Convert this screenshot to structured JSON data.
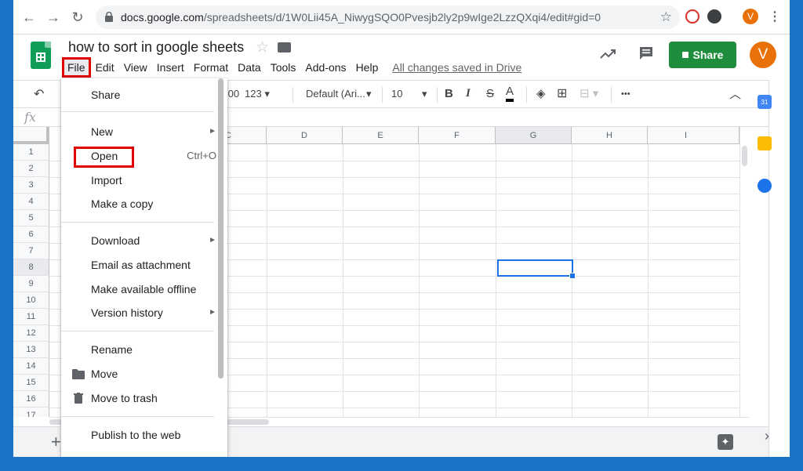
{
  "browser": {
    "url_host": "docs.google.com",
    "url_path": "/spreadsheets/d/1W0Lii45A_NiwygSQO0Pvesjb2ly2p9wIge2LzzQXqi4/edit#gid=0",
    "profile_initial": "V"
  },
  "header": {
    "doc_title": "how to sort in google sheets",
    "saved_status": "All changes saved in Drive",
    "share_label": "Share",
    "profile_initial": "V"
  },
  "menubar": [
    "File",
    "Edit",
    "View",
    "Insert",
    "Format",
    "Data",
    "Tools",
    "Add-ons",
    "Help"
  ],
  "toolbar": {
    "decimal_increase": ".00",
    "number_format": "123",
    "font": "Default (Ari...",
    "font_size": "10",
    "bold": "B",
    "italic": "I",
    "strikethrough": "S",
    "text_color": "A",
    "more": "•••"
  },
  "formula_bar": {
    "fx": "fx"
  },
  "grid": {
    "visible_columns": [
      "C",
      "D",
      "E",
      "F",
      "G",
      "H",
      "I"
    ],
    "rows": [
      "1",
      "2",
      "3",
      "4",
      "5",
      "6",
      "7",
      "8",
      "9",
      "10",
      "11",
      "12",
      "13",
      "14",
      "15",
      "16",
      "17"
    ],
    "selected_column": "G",
    "selected_row": "8"
  },
  "file_menu": {
    "items": [
      {
        "label": "Share"
      },
      {
        "label": "New",
        "submenu": true
      },
      {
        "label": "Open",
        "shortcut": "Ctrl+O"
      },
      {
        "label": "Import"
      },
      {
        "label": "Make a copy"
      },
      {
        "label": "Download",
        "submenu": true
      },
      {
        "label": "Email as attachment"
      },
      {
        "label": "Make available offline"
      },
      {
        "label": "Version history",
        "submenu": true
      },
      {
        "label": "Rename"
      },
      {
        "label": "Move",
        "icon": "folder-icon"
      },
      {
        "label": "Move to trash",
        "icon": "trash-icon"
      },
      {
        "label": "Publish to the web"
      }
    ]
  },
  "side_panel": {
    "calendar_label": "31"
  },
  "colors": {
    "share_green": "#1e8e3e",
    "profile_orange": "#e8710a",
    "highlight_red": "#e00000",
    "selection_blue": "#1a73e8",
    "sheets_green": "#0f9d58"
  }
}
